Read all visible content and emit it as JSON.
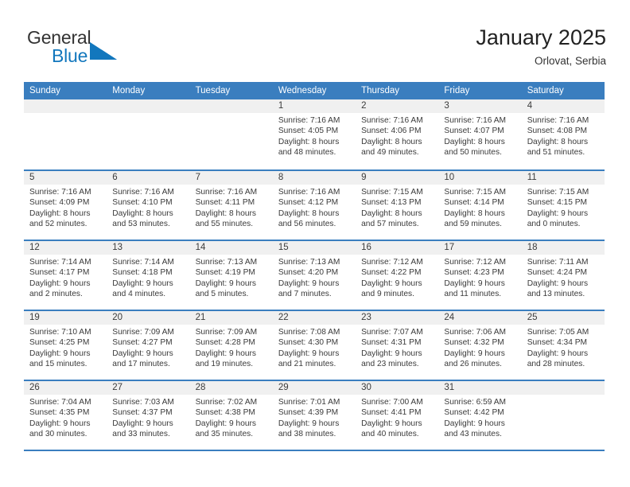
{
  "brand": {
    "name_top": "General",
    "name_bottom": "Blue",
    "triangle_color": "#1277bd",
    "top_color": "#333333",
    "bottom_color": "#1277bd"
  },
  "header": {
    "title": "January 2025",
    "subtitle": "Orlovat, Serbia"
  },
  "theme": {
    "accent": "#3a7ebf",
    "date_band": "#f0f0f0",
    "text": "#3a3a3a"
  },
  "calendar": {
    "weekday_headers": [
      "Sunday",
      "Monday",
      "Tuesday",
      "Wednesday",
      "Thursday",
      "Friday",
      "Saturday"
    ],
    "weeks": [
      [
        {
          "day": "",
          "lines": []
        },
        {
          "day": "",
          "lines": []
        },
        {
          "day": "",
          "lines": []
        },
        {
          "day": "1",
          "lines": [
            "Sunrise: 7:16 AM",
            "Sunset: 4:05 PM",
            "Daylight: 8 hours",
            "and 48 minutes."
          ]
        },
        {
          "day": "2",
          "lines": [
            "Sunrise: 7:16 AM",
            "Sunset: 4:06 PM",
            "Daylight: 8 hours",
            "and 49 minutes."
          ]
        },
        {
          "day": "3",
          "lines": [
            "Sunrise: 7:16 AM",
            "Sunset: 4:07 PM",
            "Daylight: 8 hours",
            "and 50 minutes."
          ]
        },
        {
          "day": "4",
          "lines": [
            "Sunrise: 7:16 AM",
            "Sunset: 4:08 PM",
            "Daylight: 8 hours",
            "and 51 minutes."
          ]
        }
      ],
      [
        {
          "day": "5",
          "lines": [
            "Sunrise: 7:16 AM",
            "Sunset: 4:09 PM",
            "Daylight: 8 hours",
            "and 52 minutes."
          ]
        },
        {
          "day": "6",
          "lines": [
            "Sunrise: 7:16 AM",
            "Sunset: 4:10 PM",
            "Daylight: 8 hours",
            "and 53 minutes."
          ]
        },
        {
          "day": "7",
          "lines": [
            "Sunrise: 7:16 AM",
            "Sunset: 4:11 PM",
            "Daylight: 8 hours",
            "and 55 minutes."
          ]
        },
        {
          "day": "8",
          "lines": [
            "Sunrise: 7:16 AM",
            "Sunset: 4:12 PM",
            "Daylight: 8 hours",
            "and 56 minutes."
          ]
        },
        {
          "day": "9",
          "lines": [
            "Sunrise: 7:15 AM",
            "Sunset: 4:13 PM",
            "Daylight: 8 hours",
            "and 57 minutes."
          ]
        },
        {
          "day": "10",
          "lines": [
            "Sunrise: 7:15 AM",
            "Sunset: 4:14 PM",
            "Daylight: 8 hours",
            "and 59 minutes."
          ]
        },
        {
          "day": "11",
          "lines": [
            "Sunrise: 7:15 AM",
            "Sunset: 4:15 PM",
            "Daylight: 9 hours",
            "and 0 minutes."
          ]
        }
      ],
      [
        {
          "day": "12",
          "lines": [
            "Sunrise: 7:14 AM",
            "Sunset: 4:17 PM",
            "Daylight: 9 hours",
            "and 2 minutes."
          ]
        },
        {
          "day": "13",
          "lines": [
            "Sunrise: 7:14 AM",
            "Sunset: 4:18 PM",
            "Daylight: 9 hours",
            "and 4 minutes."
          ]
        },
        {
          "day": "14",
          "lines": [
            "Sunrise: 7:13 AM",
            "Sunset: 4:19 PM",
            "Daylight: 9 hours",
            "and 5 minutes."
          ]
        },
        {
          "day": "15",
          "lines": [
            "Sunrise: 7:13 AM",
            "Sunset: 4:20 PM",
            "Daylight: 9 hours",
            "and 7 minutes."
          ]
        },
        {
          "day": "16",
          "lines": [
            "Sunrise: 7:12 AM",
            "Sunset: 4:22 PM",
            "Daylight: 9 hours",
            "and 9 minutes."
          ]
        },
        {
          "day": "17",
          "lines": [
            "Sunrise: 7:12 AM",
            "Sunset: 4:23 PM",
            "Daylight: 9 hours",
            "and 11 minutes."
          ]
        },
        {
          "day": "18",
          "lines": [
            "Sunrise: 7:11 AM",
            "Sunset: 4:24 PM",
            "Daylight: 9 hours",
            "and 13 minutes."
          ]
        }
      ],
      [
        {
          "day": "19",
          "lines": [
            "Sunrise: 7:10 AM",
            "Sunset: 4:25 PM",
            "Daylight: 9 hours",
            "and 15 minutes."
          ]
        },
        {
          "day": "20",
          "lines": [
            "Sunrise: 7:09 AM",
            "Sunset: 4:27 PM",
            "Daylight: 9 hours",
            "and 17 minutes."
          ]
        },
        {
          "day": "21",
          "lines": [
            "Sunrise: 7:09 AM",
            "Sunset: 4:28 PM",
            "Daylight: 9 hours",
            "and 19 minutes."
          ]
        },
        {
          "day": "22",
          "lines": [
            "Sunrise: 7:08 AM",
            "Sunset: 4:30 PM",
            "Daylight: 9 hours",
            "and 21 minutes."
          ]
        },
        {
          "day": "23",
          "lines": [
            "Sunrise: 7:07 AM",
            "Sunset: 4:31 PM",
            "Daylight: 9 hours",
            "and 23 minutes."
          ]
        },
        {
          "day": "24",
          "lines": [
            "Sunrise: 7:06 AM",
            "Sunset: 4:32 PM",
            "Daylight: 9 hours",
            "and 26 minutes."
          ]
        },
        {
          "day": "25",
          "lines": [
            "Sunrise: 7:05 AM",
            "Sunset: 4:34 PM",
            "Daylight: 9 hours",
            "and 28 minutes."
          ]
        }
      ],
      [
        {
          "day": "26",
          "lines": [
            "Sunrise: 7:04 AM",
            "Sunset: 4:35 PM",
            "Daylight: 9 hours",
            "and 30 minutes."
          ]
        },
        {
          "day": "27",
          "lines": [
            "Sunrise: 7:03 AM",
            "Sunset: 4:37 PM",
            "Daylight: 9 hours",
            "and 33 minutes."
          ]
        },
        {
          "day": "28",
          "lines": [
            "Sunrise: 7:02 AM",
            "Sunset: 4:38 PM",
            "Daylight: 9 hours",
            "and 35 minutes."
          ]
        },
        {
          "day": "29",
          "lines": [
            "Sunrise: 7:01 AM",
            "Sunset: 4:39 PM",
            "Daylight: 9 hours",
            "and 38 minutes."
          ]
        },
        {
          "day": "30",
          "lines": [
            "Sunrise: 7:00 AM",
            "Sunset: 4:41 PM",
            "Daylight: 9 hours",
            "and 40 minutes."
          ]
        },
        {
          "day": "31",
          "lines": [
            "Sunrise: 6:59 AM",
            "Sunset: 4:42 PM",
            "Daylight: 9 hours",
            "and 43 minutes."
          ]
        },
        {
          "day": "",
          "lines": []
        }
      ]
    ]
  }
}
